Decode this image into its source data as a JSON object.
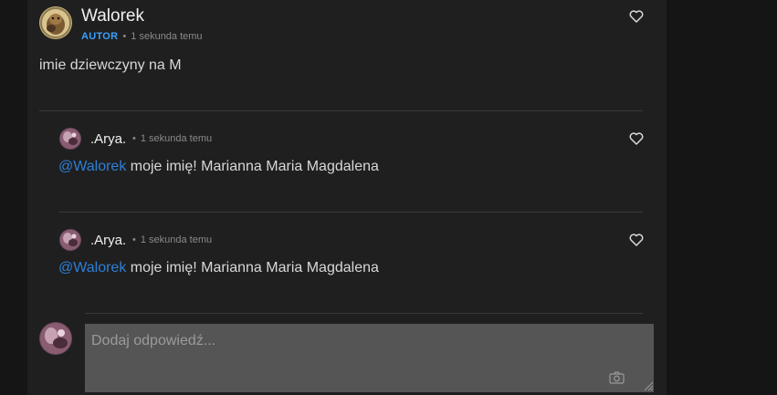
{
  "post": {
    "author": "Walorek",
    "badge": "AUTOR",
    "separator": "•",
    "time": "1 sekunda temu",
    "text": "imie dziewczyny na M",
    "like_icon": "heart-icon"
  },
  "replies": [
    {
      "author": ".Arya.",
      "separator": "•",
      "time": "1 sekunda temu",
      "mention": "@Walorek",
      "text": " moje imię! Marianna Maria Magdalena",
      "like_icon": "heart-icon"
    },
    {
      "author": ".Arya.",
      "separator": "•",
      "time": "1 sekunda temu",
      "mention": "@Walorek",
      "text": " moje imię! Marianna Maria Magdalena",
      "like_icon": "heart-icon"
    }
  ],
  "reply_form": {
    "placeholder": "Dodaj odpowiedź...",
    "attach_icon": "camera-icon"
  },
  "colors": {
    "background": "#151515",
    "panel": "#1f1f1f",
    "author_badge": "#3aa0ff",
    "mention": "#2f7fd6",
    "input": "#555555"
  }
}
